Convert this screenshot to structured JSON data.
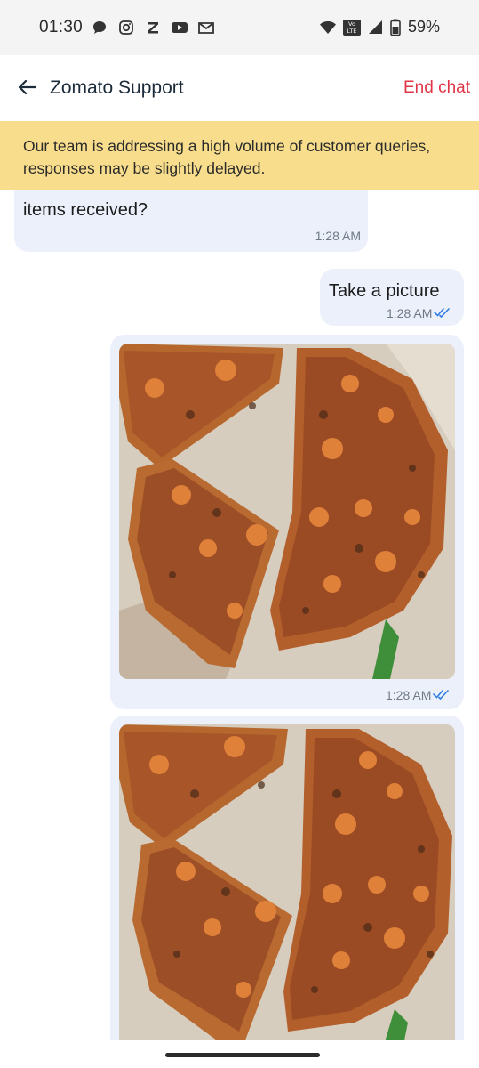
{
  "status_bar": {
    "time": "01:30",
    "battery": "59%",
    "network_badge": "Vo LTE",
    "left_icons": [
      "chat-bubble-icon",
      "instagram-icon",
      "zomato-z-icon",
      "youtube-icon",
      "gmail-icon"
    ],
    "right_icons": [
      "wifi-icon",
      "volte-icon",
      "signal-icon",
      "battery-icon"
    ]
  },
  "header": {
    "title": "Zomato Support",
    "end_chat_label": "End chat",
    "accent_color": "#e03546"
  },
  "banner": {
    "text": "Our team is addressing a high volume of customer queries, responses may be slightly delayed.",
    "color": "#f8de8c"
  },
  "messages": [
    {
      "side": "left",
      "text": "items received?",
      "time": "1:28 AM"
    },
    {
      "side": "right",
      "text": "Take a picture",
      "time": "1:28 AM",
      "read": true
    },
    {
      "side": "right",
      "type": "image",
      "image": "pizza-photo",
      "time": "1:28 AM",
      "read": true
    },
    {
      "side": "right",
      "type": "image",
      "image": "pizza-photo"
    }
  ],
  "colors": {
    "bubble_bg": "#ecf0fb",
    "read_tick": "#2f7de1",
    "time_text": "#6f7a86"
  }
}
